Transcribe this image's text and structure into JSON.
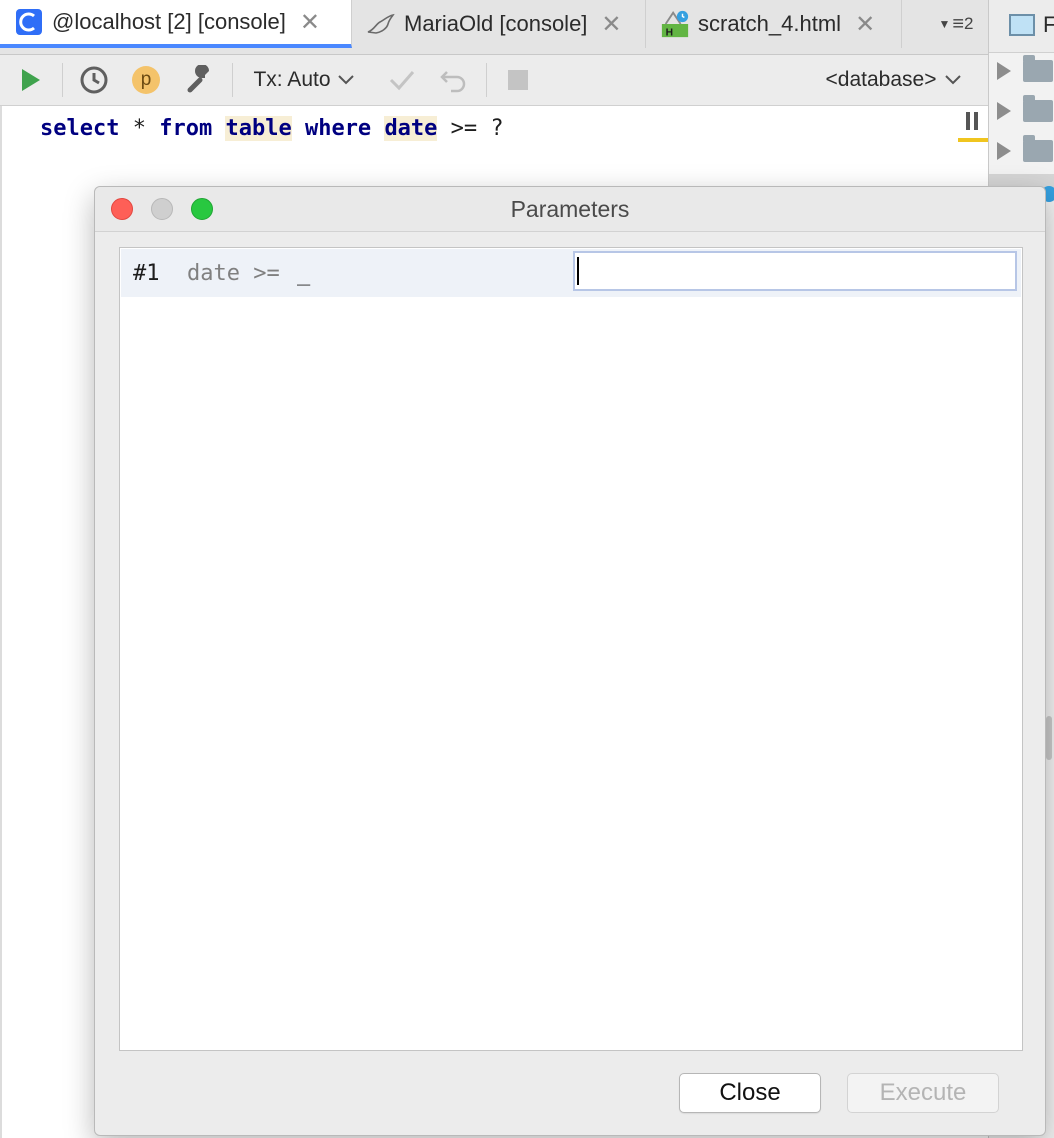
{
  "tabs": [
    {
      "label": "@localhost [2] [console]",
      "icon": "console-icon",
      "active": true
    },
    {
      "label": "MariaOld [console]",
      "icon": "mariadb-seal-icon",
      "active": false
    },
    {
      "label": "scratch_4.html",
      "icon": "html-scratch-icon",
      "active": false
    }
  ],
  "tab_overflow": {
    "count": "2"
  },
  "toolbar": {
    "tx_label": "Tx: Auto",
    "profile_label": "p",
    "database_label": "<database>"
  },
  "editor": {
    "kw_select": "select",
    "op_star": " * ",
    "kw_from": "from",
    "kw_table": "table",
    "kw_where": "where",
    "kw_date": "date",
    "op_rest": " >= ?"
  },
  "right_panel": {
    "header_fragment": "F"
  },
  "dialog": {
    "title": "Parameters",
    "parameter": {
      "number": "#1",
      "expression": "date >=",
      "placeholder_mark": "_",
      "value": ""
    },
    "close_label": "Close",
    "execute_label": "Execute"
  },
  "colors": {
    "accent": "#4a88ff",
    "keyword": "#000080",
    "highlight": "#f7eed5",
    "run_green": "#3fa34d",
    "close_red": "#fe5f57",
    "zoom_green": "#28c840"
  }
}
